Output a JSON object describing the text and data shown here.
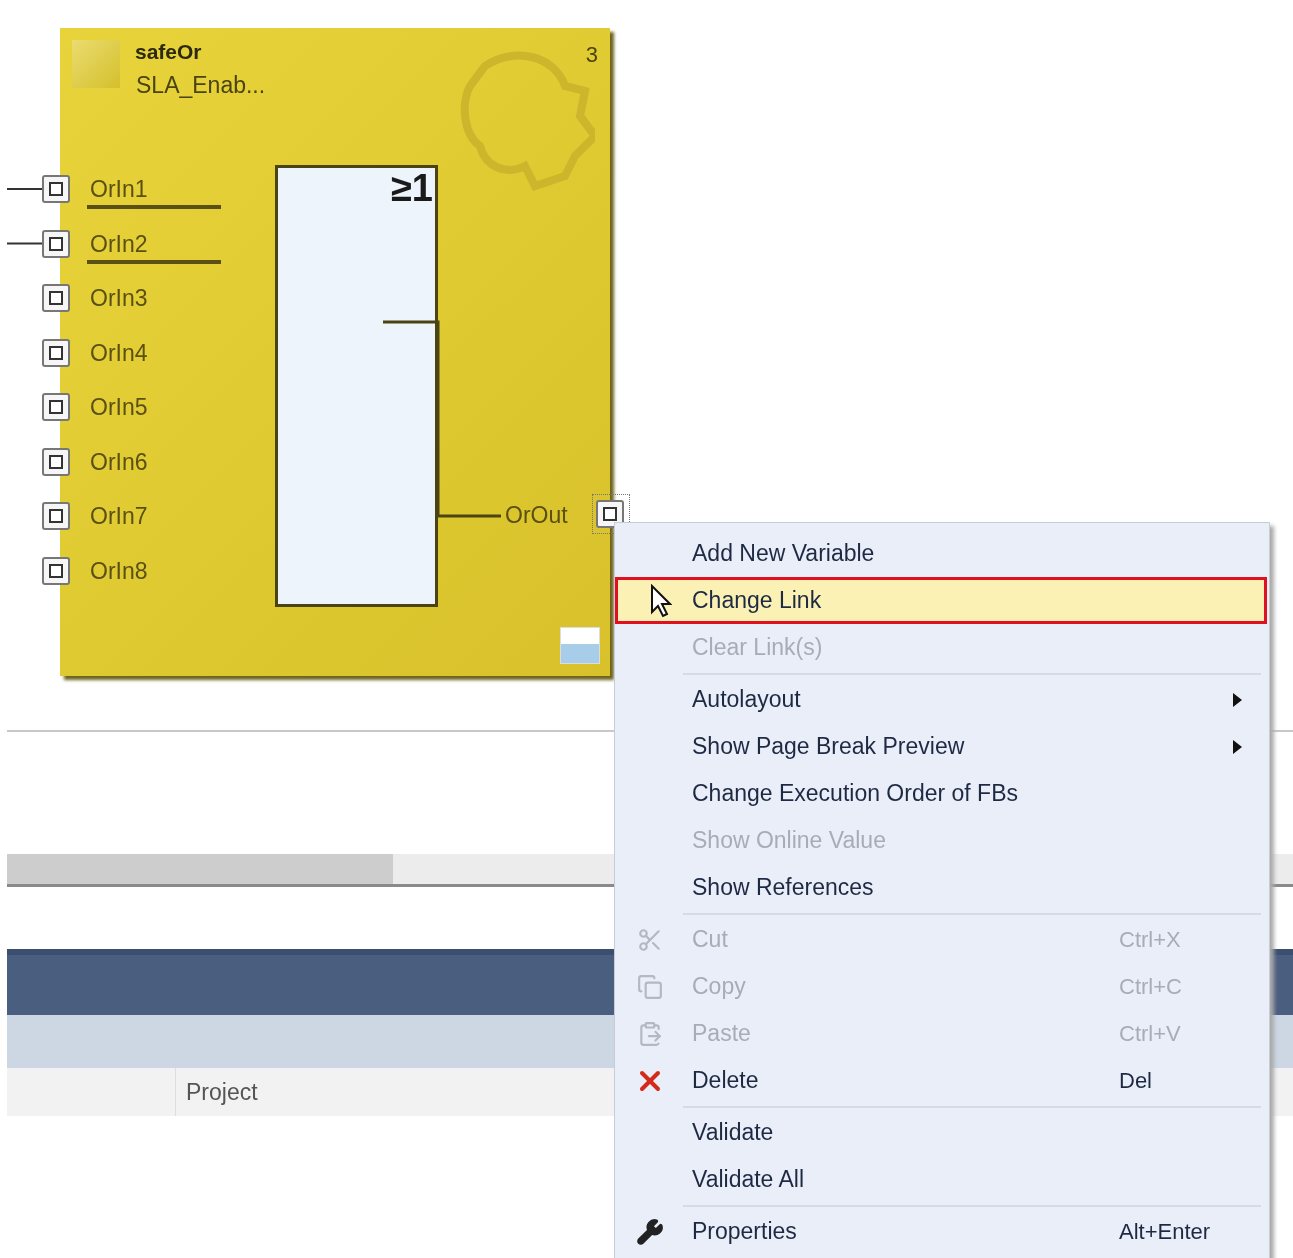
{
  "diagram": {
    "block": {
      "type_name": "safeOr",
      "instance_name": "SLA_Enab...",
      "execution_order": "3",
      "operator": "≥1",
      "inputs": [
        {
          "name": "OrIn1",
          "connected": true
        },
        {
          "name": "OrIn2",
          "connected": true
        },
        {
          "name": "OrIn3",
          "connected": false
        },
        {
          "name": "OrIn4",
          "connected": false
        },
        {
          "name": "OrIn5",
          "connected": false
        },
        {
          "name": "OrIn6",
          "connected": false
        },
        {
          "name": "OrIn7",
          "connected": false
        },
        {
          "name": "OrIn8",
          "connected": false
        }
      ],
      "output": {
        "name": "OrOut",
        "selected": true
      }
    }
  },
  "panel": {
    "columns": [
      {
        "label": "Project"
      }
    ]
  },
  "context_menu": {
    "items": [
      {
        "kind": "item",
        "label": "Add New Variable",
        "disabled": false,
        "selected": false,
        "submenu": false
      },
      {
        "kind": "item",
        "label": "Change Link",
        "disabled": false,
        "selected": true,
        "submenu": false
      },
      {
        "kind": "item",
        "label": "Clear Link(s)",
        "disabled": true,
        "selected": false,
        "submenu": false
      },
      {
        "kind": "separator"
      },
      {
        "kind": "item",
        "label": "Autolayout",
        "disabled": false,
        "selected": false,
        "submenu": true
      },
      {
        "kind": "item",
        "label": "Show Page Break Preview",
        "disabled": false,
        "selected": false,
        "submenu": true
      },
      {
        "kind": "item",
        "label": "Change Execution Order of FBs",
        "disabled": false,
        "selected": false,
        "submenu": false
      },
      {
        "kind": "item",
        "label": "Show Online Value",
        "disabled": true,
        "selected": false,
        "submenu": false
      },
      {
        "kind": "item",
        "label": "Show References",
        "disabled": false,
        "selected": false,
        "submenu": false
      },
      {
        "kind": "separator"
      },
      {
        "kind": "item",
        "label": "Cut",
        "shortcut": "Ctrl+X",
        "disabled": true,
        "selected": false,
        "submenu": false
      },
      {
        "kind": "item",
        "label": "Copy",
        "shortcut": "Ctrl+C",
        "disabled": true,
        "selected": false,
        "submenu": false
      },
      {
        "kind": "item",
        "label": "Paste",
        "shortcut": "Ctrl+V",
        "disabled": true,
        "selected": false,
        "submenu": false
      },
      {
        "kind": "item",
        "label": "Delete",
        "shortcut": "Del",
        "disabled": false,
        "selected": false,
        "submenu": false
      },
      {
        "kind": "separator"
      },
      {
        "kind": "item",
        "label": "Validate",
        "disabled": false,
        "selected": false,
        "submenu": false
      },
      {
        "kind": "item",
        "label": "Validate All",
        "disabled": false,
        "selected": false,
        "submenu": false
      },
      {
        "kind": "separator"
      },
      {
        "kind": "item",
        "label": "Properties",
        "shortcut": "Alt+Enter",
        "disabled": false,
        "selected": false,
        "submenu": false
      }
    ]
  }
}
